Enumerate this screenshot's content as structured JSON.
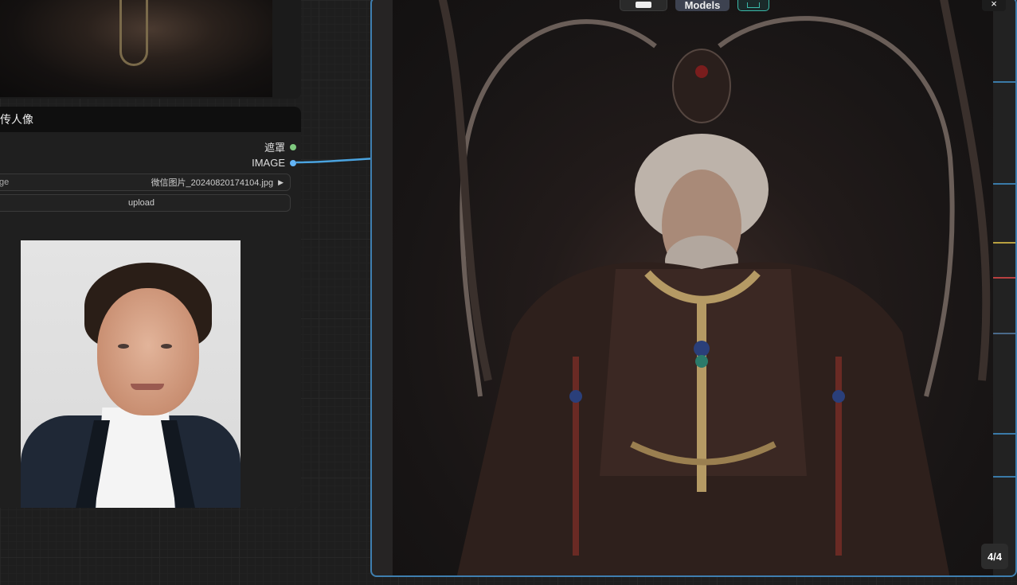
{
  "load_image_node": {
    "title": "传人像",
    "outputs": [
      {
        "label": "遮罩",
        "color": "#7fc97f"
      },
      {
        "label": "IMAGE",
        "color": "#64b5f6"
      }
    ],
    "image_widget": {
      "label": "ge",
      "value": "微信图片_20240820174104.jpg"
    },
    "upload_label": "upload"
  },
  "viewer": {
    "counter": "4/4",
    "close_label": "×",
    "toolbar": {
      "middle_label": "Models"
    }
  },
  "colors": {
    "link_blue": "#4aa3df",
    "viewer_border": "#3f7fb0",
    "canvas_bg": "#1e1e1e"
  }
}
